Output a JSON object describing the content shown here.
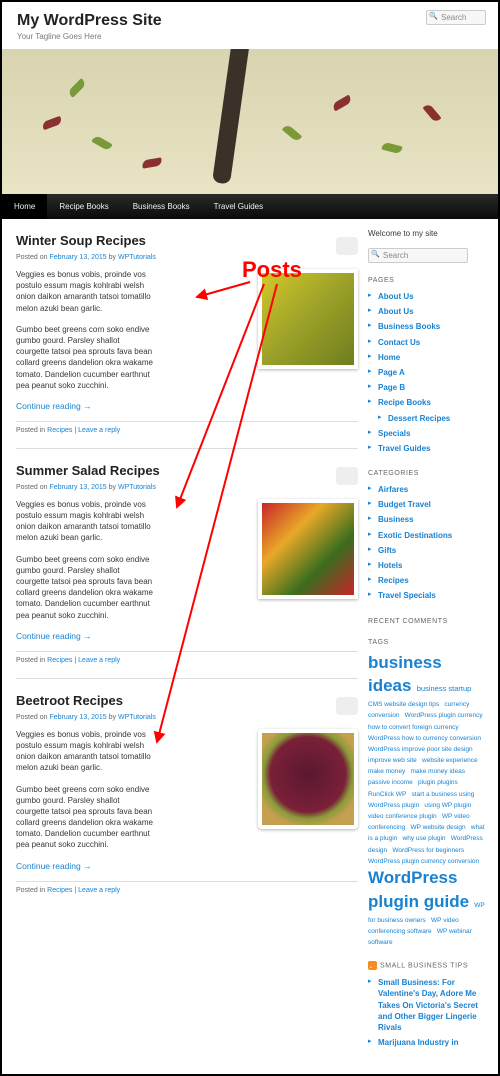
{
  "site": {
    "title": "My WordPress Site",
    "tagline": "Your Tagline Goes Here"
  },
  "search": {
    "placeholder": "Search"
  },
  "nav": {
    "items": [
      "Home",
      "Recipe Books",
      "Business Books",
      "Travel Guides"
    ]
  },
  "annotation": {
    "label": "Posts"
  },
  "posts": [
    {
      "title": "Winter Soup Recipes",
      "date": "February 13, 2015",
      "author": "WPTutorials",
      "p1": "Veggies es bonus vobis, proinde vos postulo essum magis kohlrabi welsh onion daikon amaranth tatsoi tomatillo melon azuki bean garlic.",
      "p2": "Gumbo beet greens corn soko endive gumbo gourd. Parsley shallot courgette tatsoi pea sprouts fava bean collard greens dandelion okra wakame tomato. Dandelion cucumber earthnut pea peanut soko zucchini.",
      "continue": "Continue reading →",
      "category": "Recipes",
      "reply": "Leave a reply"
    },
    {
      "title": "Summer Salad Recipes",
      "date": "February 13, 2015",
      "author": "WPTutorials",
      "p1": "Veggies es bonus vobis, proinde vos postulo essum magis kohlrabi welsh onion daikon amaranth tatsoi tomatillo melon azuki bean garlic.",
      "p2": "Gumbo beet greens corn soko endive gumbo gourd. Parsley shallot courgette tatsoi pea sprouts fava bean collard greens dandelion okra wakame tomato. Dandelion cucumber earthnut pea peanut soko zucchini.",
      "continue": "Continue reading →",
      "category": "Recipes",
      "reply": "Leave a reply"
    },
    {
      "title": "Beetroot Recipes",
      "date": "February 13, 2015",
      "author": "WPTutorials",
      "p1": "Veggies es bonus vobis, proinde vos postulo essum magis kohlrabi welsh onion daikon amaranth tatsoi tomatillo melon azuki bean garlic.",
      "p2": "Gumbo beet greens corn soko endive gumbo gourd. Parsley shallot courgette tatsoi pea sprouts fava bean collard greens dandelion okra wakame tomato. Dandelion cucumber earthnut pea peanut soko zucchini.",
      "continue": "Continue reading →",
      "category": "Recipes",
      "reply": "Leave a reply"
    }
  ],
  "meta_labels": {
    "posted_on": "Posted on ",
    "by": " by ",
    "posted_in": "Posted in ",
    "sep": " | "
  },
  "sidebar": {
    "welcome": "Welcome to my site",
    "pages_title": "PAGES",
    "pages": [
      "About Us",
      "About Us",
      "Business Books",
      "Contact Us",
      "Home",
      "Page A",
      "Page B",
      "Recipe Books"
    ],
    "pages_child": "Dessert Recipes",
    "pages2": [
      "Specials",
      "Travel Guides"
    ],
    "cats_title": "CATEGORIES",
    "cats": [
      "Airfares",
      "Budget Travel",
      "Business",
      "Exotic Destinations",
      "Gifts",
      "Hotels",
      "Recipes",
      "Travel Specials"
    ],
    "recent_title": "RECENT COMMENTS",
    "tags_title": "TAGS",
    "tags": {
      "t1": "business ideas",
      "t2": "business startup",
      "t3": "CMS website design tips",
      "t4": "currency conversion",
      "t5": "WordPress plugin currency",
      "t6": "how to convert foreign currency",
      "t7": "WordPress how to currency conversion",
      "t8": "WordPress improve poor site design",
      "t9": "improve web site",
      "t10": "website experience",
      "t11": "make money",
      "t12": "make money ideas",
      "t13": "passive income",
      "t14": "plugin plugins",
      "t15": "RunClick WP",
      "t16": "start a business using WordPress plugin",
      "t17": "using WP plugin",
      "t18": "video conference plugin",
      "t19": "WP video conferencing",
      "t20": "WP website design",
      "t21": "what is a plugin",
      "t22": "why use plugin",
      "t23": "WordPress design",
      "t24": "WordPress for beginners",
      "t25": "WordPress plugin currency conversion",
      "t26": "WordPress plugin guide",
      "t27": "WP for business owners",
      "t28": "WP video conferencing software",
      "t29": "WP webinar software"
    },
    "rss_title": "SMALL BUSINESS TIPS",
    "rss_items": [
      "Small Business: For Valentine's Day, Adore Me Takes On Victoria's Secret and Other Bigger Lingerie Rivals",
      "Marijuana Industry in"
    ]
  }
}
